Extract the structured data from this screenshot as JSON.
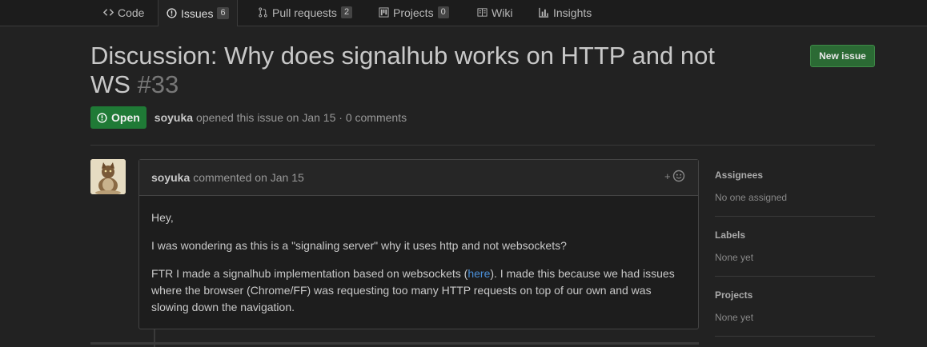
{
  "nav": {
    "tabs": [
      {
        "label": "Code",
        "icon": "code-icon"
      },
      {
        "label": "Issues",
        "count": "6",
        "icon": "issue-opened-icon"
      },
      {
        "label": "Pull requests",
        "count": "2",
        "icon": "git-pull-request-icon"
      },
      {
        "label": "Projects",
        "count": "0",
        "icon": "project-icon"
      },
      {
        "label": "Wiki",
        "icon": "book-icon"
      },
      {
        "label": "Insights",
        "icon": "graph-icon"
      }
    ],
    "selected": "Issues"
  },
  "issue": {
    "title": "Discussion: Why does signalhub works on HTTP and not WS",
    "number": "#33",
    "state": "Open",
    "author": "soyuka",
    "opened_text": "opened this issue on Jan 15 · 0 comments"
  },
  "new_issue_label": "New issue",
  "comment": {
    "author": "soyuka",
    "meta": "commented on Jan 15",
    "reaction_label": "+",
    "paragraphs": {
      "p1": "Hey,",
      "p2": "I was wondering as this is a \"signaling server\" why it uses http and not websockets?",
      "p3_before": "FTR I made a signalhub implementation based on websockets (",
      "p3_link": "here",
      "p3_after": "). I made this because we had issues where the browser (Chrome/FF) was requesting too many HTTP requests on top of our own and was slowing down the navigation."
    }
  },
  "sidebar": {
    "assignees": {
      "heading": "Assignees",
      "value": "No one assigned"
    },
    "labels": {
      "heading": "Labels",
      "value": "None yet"
    },
    "projects": {
      "heading": "Projects",
      "value": "None yet"
    }
  },
  "colors": {
    "background": "#222222",
    "open_badge": "#1f7a36",
    "new_issue_button": "#2b6a34",
    "link": "#4a8fd8"
  }
}
